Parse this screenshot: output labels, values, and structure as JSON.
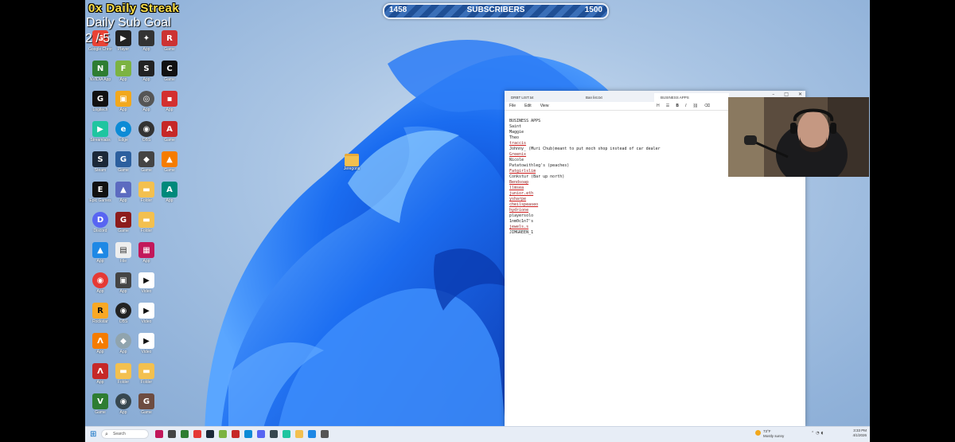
{
  "overlay": {
    "streak": "0x Daily Streak",
    "sub_goal_label": "Daily Sub Goal",
    "sub_goal_count": "2 / 5",
    "subscribers_label": "SUBSCRIBERS",
    "subscribers_current": "1458",
    "subscribers_goal": "1500"
  },
  "desktop": {
    "folder_label": "Jeregons"
  },
  "notepad": {
    "tabs": [
      "DRBT LIST.txt",
      "Ban list.txt",
      "BUSINESS APPS"
    ],
    "active_tab": 2,
    "menu": [
      "File",
      "Edit",
      "View"
    ],
    "lines": [
      {
        "text": "BUSINESS APPS",
        "flag": false
      },
      {
        "text": "Saint",
        "flag": false
      },
      {
        "text": "Maggie",
        "flag": false
      },
      {
        "text": "Theo",
        "flag": false
      },
      {
        "text": "traccis",
        "flag": true
      },
      {
        "text": "Johnny_ (Muri Chub)meant to put moch shop instead of car dealer",
        "flag": false
      },
      {
        "text": "Greenix",
        "flag": true
      },
      {
        "text": "Nicole",
        "flag": false
      },
      {
        "text": "Patatowithleg's (peaches)",
        "flag": false
      },
      {
        "text": "Fatgirlslim",
        "flag": true
      },
      {
        "text": "Conkstur (Bar up north)",
        "flag": false
      },
      {
        "text": "Bendsoap",
        "flag": true
      },
      {
        "text": "llmsea",
        "flag": true
      },
      {
        "text": "junior.eth",
        "flag": true
      },
      {
        "text": "ysharpe",
        "flag": true
      },
      {
        "text": "cheilspeaseo",
        "flag": true
      },
      {
        "text": "hydrione",
        "flag": true
      },
      {
        "text": "playersolo",
        "flag": false
      },
      {
        "text": "1nm0c1n7's",
        "flag": false
      },
      {
        "text": "jewels.s",
        "flag": true
      },
      {
        "text": "JIMGREEN_1",
        "flag": false
      }
    ]
  },
  "taskbar": {
    "search_placeholder": "Search",
    "weather_temp": "73°F",
    "weather_desc": "Mostly sunny",
    "time": "3:33 PM",
    "date": "4/1/2026"
  },
  "colors": {
    "accent": "#0067c0",
    "streak": "#ffe14a",
    "subbar": "#2a5da8"
  }
}
